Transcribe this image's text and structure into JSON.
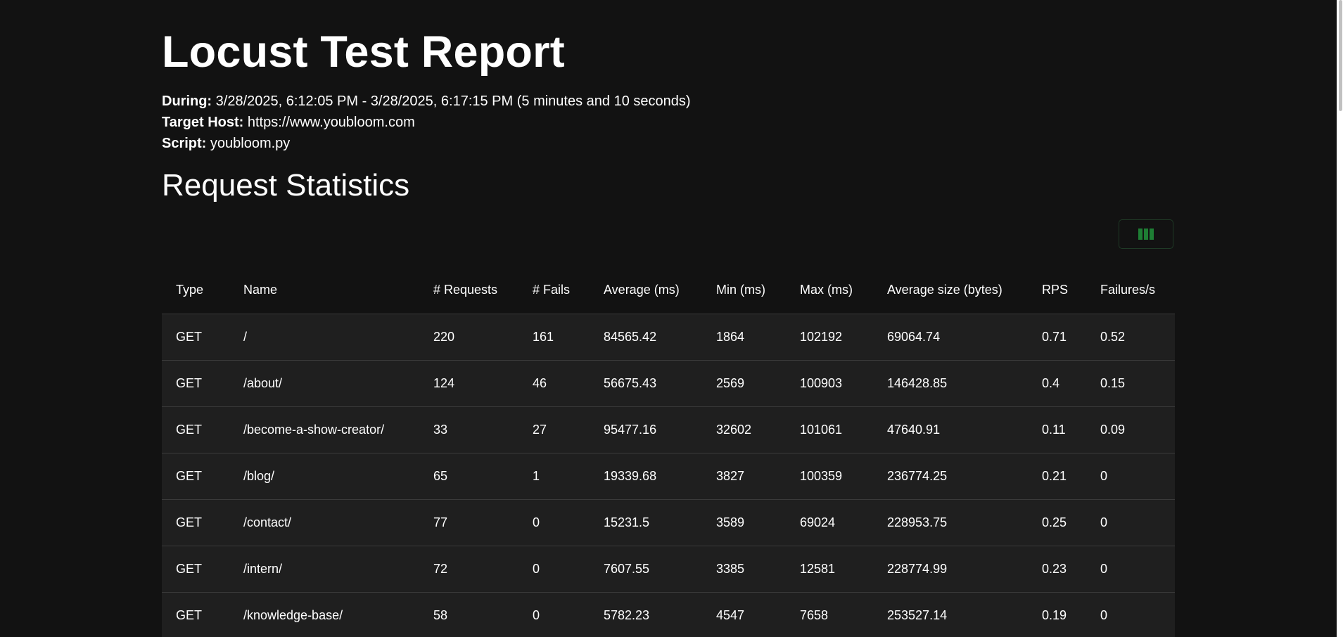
{
  "report": {
    "title": "Locust Test Report",
    "during_label": "During:",
    "during_value": "3/28/2025, 6:12:05 PM - 3/28/2025, 6:17:15 PM (5 minutes and 10 seconds)",
    "target_host_label": "Target Host:",
    "target_host_value": "https://www.youbloom.com",
    "script_label": "Script:",
    "script_value": "youbloom.py"
  },
  "request_statistics": {
    "title": "Request Statistics",
    "columns_button_icon": "columns-icon",
    "accent_color": "#1e7e34",
    "columns": [
      "Type",
      "Name",
      "# Requests",
      "# Fails",
      "Average (ms)",
      "Min (ms)",
      "Max (ms)",
      "Average size (bytes)",
      "RPS",
      "Failures/s"
    ],
    "rows": [
      [
        "GET",
        "/",
        "220",
        "161",
        "84565.42",
        "1864",
        "102192",
        "69064.74",
        "0.71",
        "0.52"
      ],
      [
        "GET",
        "/about/",
        "124",
        "46",
        "56675.43",
        "2569",
        "100903",
        "146428.85",
        "0.4",
        "0.15"
      ],
      [
        "GET",
        "/become-a-show-creator/",
        "33",
        "27",
        "95477.16",
        "32602",
        "101061",
        "47640.91",
        "0.11",
        "0.09"
      ],
      [
        "GET",
        "/blog/",
        "65",
        "1",
        "19339.68",
        "3827",
        "100359",
        "236774.25",
        "0.21",
        "0"
      ],
      [
        "GET",
        "/contact/",
        "77",
        "0",
        "15231.5",
        "3589",
        "69024",
        "228953.75",
        "0.25",
        "0"
      ],
      [
        "GET",
        "/intern/",
        "72",
        "0",
        "7607.55",
        "3385",
        "12581",
        "228774.99",
        "0.23",
        "0"
      ],
      [
        "GET",
        "/knowledge-base/",
        "58",
        "0",
        "5782.23",
        "4547",
        "7658",
        "253527.14",
        "0.19",
        "0"
      ]
    ]
  }
}
